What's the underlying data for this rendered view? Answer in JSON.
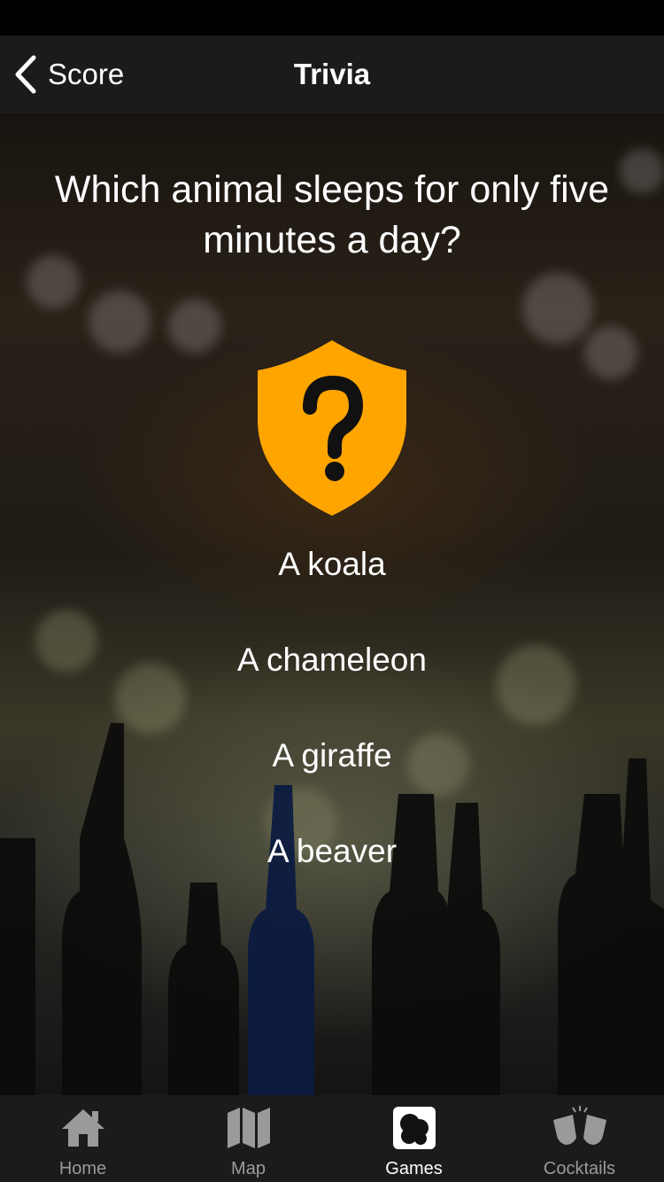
{
  "nav": {
    "back_label": "Score",
    "title": "Trivia"
  },
  "question": {
    "text": "Which animal sleeps for only five minutes a day?",
    "icon": "question-shield-icon",
    "icon_color": "#FFA500"
  },
  "answers": [
    {
      "label": "A koala"
    },
    {
      "label": "A chameleon"
    },
    {
      "label": "A giraffe"
    },
    {
      "label": "A beaver"
    }
  ],
  "tabs": [
    {
      "label": "Home",
      "icon": "home-icon",
      "active": false
    },
    {
      "label": "Map",
      "icon": "map-icon",
      "active": false
    },
    {
      "label": "Games",
      "icon": "games-icon",
      "active": true
    },
    {
      "label": "Cocktails",
      "icon": "cocktails-icon",
      "active": false
    }
  ]
}
